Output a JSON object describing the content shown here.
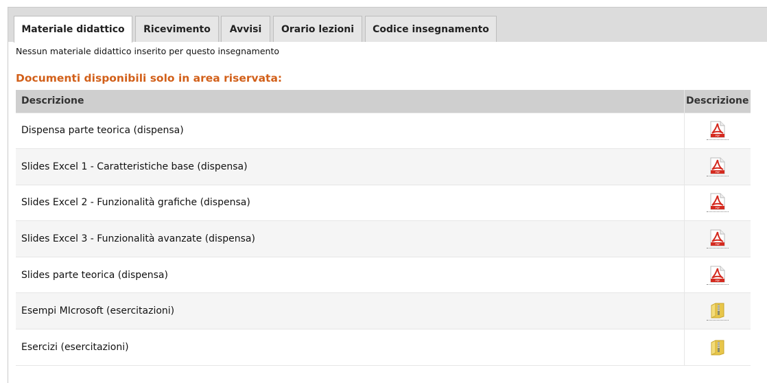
{
  "tabs": [
    {
      "label": "Materiale didattico",
      "active": true
    },
    {
      "label": "Ricevimento",
      "active": false
    },
    {
      "label": "Avvisi",
      "active": false
    },
    {
      "label": "Orario lezioni",
      "active": false
    },
    {
      "label": "Codice insegnamento",
      "active": false
    }
  ],
  "notice": "Nessun materiale didattico inserito per questo insegnamento",
  "reserved_title": "Documenti disponibili solo in area riservata:",
  "table": {
    "headers": [
      "Descrizione",
      "Descrizione"
    ],
    "rows": [
      {
        "description": "Dispensa parte teorica (dispensa)",
        "icon": "pdf-icon"
      },
      {
        "description": "Slides Excel 1 - Caratteristiche base (dispensa)",
        "icon": "pdf-icon"
      },
      {
        "description": "Slides Excel 2 - Funzionalità grafiche (dispensa)",
        "icon": "pdf-icon"
      },
      {
        "description": "Slides Excel 3 - Funzionalità avanzate (dispensa)",
        "icon": "pdf-icon"
      },
      {
        "description": "Slides parte teorica (dispensa)",
        "icon": "pdf-icon"
      },
      {
        "description": "Esempi MIcrosoft (esercitazioni)",
        "icon": "zip-folder-icon"
      },
      {
        "description": "Esercizi (esercitazioni)",
        "icon": "zip-folder-icon"
      }
    ]
  },
  "colors": {
    "accent_title": "#d2601a",
    "header_bg": "#cfcfcf",
    "tabbar_bg": "#dcdcdc",
    "pdf_red": "#d42a1f",
    "folder_yellow": "#e8c64a"
  }
}
